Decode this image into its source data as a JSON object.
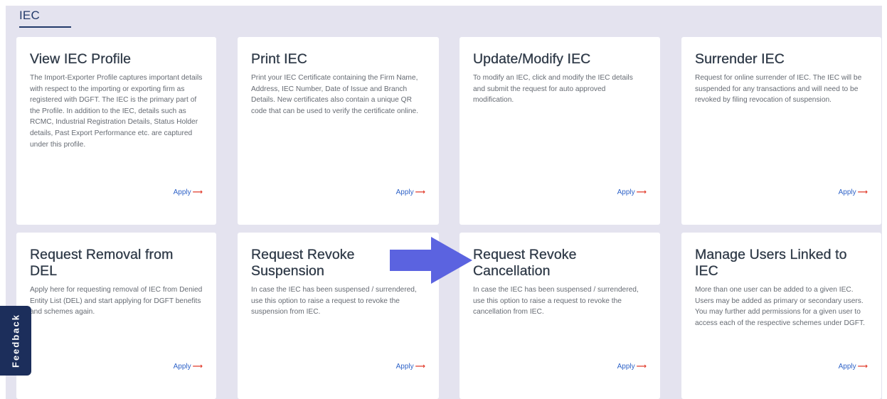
{
  "section": {
    "title": "IEC"
  },
  "cards": [
    {
      "title": "View IEC Profile",
      "description": "The Import-Exporter Profile captures important details with respect to the importing or exporting firm as registered with DGFT. The IEC is the primary part of the Profile. In addition to the IEC, details such as RCMC, Industrial Registration Details, Status Holder details, Past Export Performance etc. are captured under this profile.",
      "action": "Apply"
    },
    {
      "title": "Print IEC",
      "description": "Print your IEC Certificate containing the Firm Name, Address, IEC Number, Date of Issue and Branch Details. New certificates also contain a unique QR code that can be used to verify the certificate online.",
      "action": "Apply"
    },
    {
      "title": "Update/Modify IEC",
      "description": "To modify an IEC, click and modify the IEC details and submit the request for auto approved modification.",
      "action": "Apply"
    },
    {
      "title": "Surrender IEC",
      "description": "Request for online surrender of IEC. The IEC will be suspended for any transactions and will need to be revoked by filing revocation of suspension.",
      "action": "Apply"
    },
    {
      "title": "Request Removal from DEL",
      "description": "Apply here for requesting removal of IEC from Denied Entity List (DEL) and start applying for DGFT benefits and schemes again.",
      "action": "Apply"
    },
    {
      "title": "Request Revoke Suspension",
      "description": "In case the IEC has been suspensed / surrendered, use this option to raise a request to revoke the suspension from IEC.",
      "action": "Apply"
    },
    {
      "title": "Request Revoke Cancellation",
      "description": "In case the IEC has been suspensed / surrendered, use this option to raise a request to revoke the cancellation from IEC.",
      "action": "Apply"
    },
    {
      "title": "Manage Users Linked to IEC",
      "description": "More than one user can be added to a given IEC. Users may be added as primary or secondary users. You may further add permissions for a given user to access each of the respective schemes under DGFT.",
      "action": "Apply"
    }
  ],
  "apply_arrow_icon": "right-arrow-icon",
  "feedback": {
    "label": "Feedback"
  },
  "annotation": {
    "icon": "pointer-arrow-icon",
    "color": "#5b63e0"
  },
  "colors": {
    "background": "#e4e3ef",
    "title": "#233a6b",
    "link": "#2f63c8",
    "link_arrow": "#e13a2a",
    "feedback_bg": "#1c2e5b"
  }
}
